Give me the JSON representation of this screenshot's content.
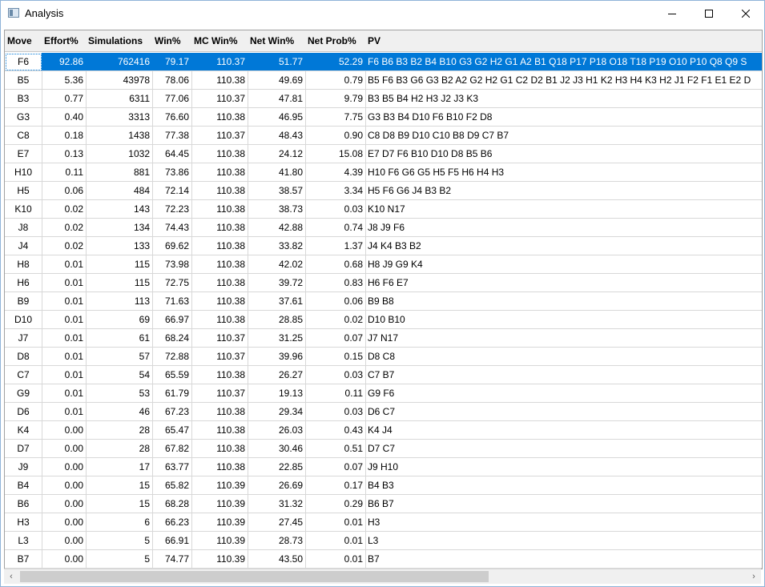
{
  "window": {
    "title": "Analysis"
  },
  "titlebar_icons": {
    "minimize": "minimize-icon",
    "maximize": "maximize-icon",
    "close": "close-icon"
  },
  "table": {
    "columns": [
      "Move",
      "Effort%",
      "Simulations",
      "Win%",
      "MC Win%",
      "Net Win%",
      "Net Prob%",
      "PV"
    ],
    "rows": [
      [
        "F6",
        "92.86",
        "762416",
        "79.17",
        "110.37",
        "51.77",
        "52.29",
        "F6 B6 B3 B2 B4 B10 G3 G2 H2 G1 A2 B1 Q18 P17 P18 O18 T18 P19 O10 P10 Q8 Q9 S"
      ],
      [
        "B5",
        "5.36",
        "43978",
        "78.06",
        "110.38",
        "49.69",
        "0.79",
        "B5 F6 B3 G6 G3 B2 A2 G2 H2 G1 C2 D2 B1 J2 J3 H1 K2 H3 H4 K3 H2 J1 F2 F1 E1 E2 D"
      ],
      [
        "B3",
        "0.77",
        "6311",
        "77.06",
        "110.37",
        "47.81",
        "9.79",
        "B3 B5 B4 H2 H3 J2 J3 K3"
      ],
      [
        "G3",
        "0.40",
        "3313",
        "76.60",
        "110.38",
        "46.95",
        "7.75",
        "G3 B3 B4 D10 F6 B10 F2 D8"
      ],
      [
        "C8",
        "0.18",
        "1438",
        "77.38",
        "110.37",
        "48.43",
        "0.90",
        "C8 D8 B9 D10 C10 B8 D9 C7 B7"
      ],
      [
        "E7",
        "0.13",
        "1032",
        "64.45",
        "110.38",
        "24.12",
        "15.08",
        "E7 D7 F6 B10 D10 D8 B5 B6"
      ],
      [
        "H10",
        "0.11",
        "881",
        "73.86",
        "110.38",
        "41.80",
        "4.39",
        "H10 F6 G6 G5 H5 F5 H6 H4 H3"
      ],
      [
        "H5",
        "0.06",
        "484",
        "72.14",
        "110.38",
        "38.57",
        "3.34",
        "H5 F6 G6 J4 B3 B2"
      ],
      [
        "K10",
        "0.02",
        "143",
        "72.23",
        "110.38",
        "38.73",
        "0.03",
        "K10 N17"
      ],
      [
        "J8",
        "0.02",
        "134",
        "74.43",
        "110.38",
        "42.88",
        "0.74",
        "J8 J9 F6"
      ],
      [
        "J4",
        "0.02",
        "133",
        "69.62",
        "110.38",
        "33.82",
        "1.37",
        "J4 K4 B3 B2"
      ],
      [
        "H8",
        "0.01",
        "115",
        "73.98",
        "110.38",
        "42.02",
        "0.68",
        "H8 J9 G9 K4"
      ],
      [
        "H6",
        "0.01",
        "115",
        "72.75",
        "110.38",
        "39.72",
        "0.83",
        "H6 F6 E7"
      ],
      [
        "B9",
        "0.01",
        "113",
        "71.63",
        "110.38",
        "37.61",
        "0.06",
        "B9 B8"
      ],
      [
        "D10",
        "0.01",
        "69",
        "66.97",
        "110.38",
        "28.85",
        "0.02",
        "D10 B10"
      ],
      [
        "J7",
        "0.01",
        "61",
        "68.24",
        "110.37",
        "31.25",
        "0.07",
        "J7 N17"
      ],
      [
        "D8",
        "0.01",
        "57",
        "72.88",
        "110.37",
        "39.96",
        "0.15",
        "D8 C8"
      ],
      [
        "C7",
        "0.01",
        "54",
        "65.59",
        "110.38",
        "26.27",
        "0.03",
        "C7 B7"
      ],
      [
        "G9",
        "0.01",
        "53",
        "61.79",
        "110.37",
        "19.13",
        "0.11",
        "G9 F6"
      ],
      [
        "D6",
        "0.01",
        "46",
        "67.23",
        "110.38",
        "29.34",
        "0.03",
        "D6 C7"
      ],
      [
        "K4",
        "0.00",
        "28",
        "65.47",
        "110.38",
        "26.03",
        "0.43",
        "K4 J4"
      ],
      [
        "D7",
        "0.00",
        "28",
        "67.82",
        "110.38",
        "30.46",
        "0.51",
        "D7 C7"
      ],
      [
        "J9",
        "0.00",
        "17",
        "63.77",
        "110.38",
        "22.85",
        "0.07",
        "J9 H10"
      ],
      [
        "B4",
        "0.00",
        "15",
        "65.82",
        "110.39",
        "26.69",
        "0.17",
        "B4 B3"
      ],
      [
        "B6",
        "0.00",
        "15",
        "68.28",
        "110.39",
        "31.32",
        "0.29",
        "B6 B7"
      ],
      [
        "H3",
        "0.00",
        "6",
        "66.23",
        "110.39",
        "27.45",
        "0.01",
        "H3"
      ],
      [
        "L3",
        "0.00",
        "5",
        "66.91",
        "110.39",
        "28.73",
        "0.01",
        "L3"
      ],
      [
        "B7",
        "0.00",
        "5",
        "74.77",
        "110.39",
        "43.50",
        "0.01",
        "B7"
      ]
    ],
    "selected_row": 0
  },
  "scrollbar": {
    "left_arrow": "‹",
    "right_arrow": "›"
  },
  "colors": {
    "selection": "#0078d7",
    "header_bg": "#f0f0f0",
    "gridline": "#d8d8d8"
  }
}
